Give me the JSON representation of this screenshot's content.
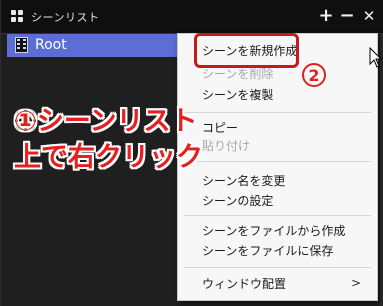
{
  "window": {
    "title": "シーンリスト",
    "add_label": "+",
    "remove_label": "−",
    "close_label": "✕"
  },
  "scene_list": {
    "items": [
      {
        "label": "Root",
        "selected": true
      }
    ]
  },
  "context_menu": {
    "items": [
      {
        "label": "シーンを新規作成",
        "disabled": false
      },
      {
        "label": "シーンを削除",
        "disabled": true
      },
      {
        "label": "シーンを複製",
        "disabled": false
      },
      {
        "label": "コピー",
        "disabled": false
      },
      {
        "label": "貼り付け",
        "disabled": true
      },
      {
        "label": "シーン名を変更",
        "disabled": false
      },
      {
        "label": "シーンの設定",
        "disabled": false
      },
      {
        "label": "シーンをファイルから作成",
        "disabled": false
      },
      {
        "label": "シーンをファイルに保存",
        "disabled": false
      },
      {
        "label": "ウィンドウ配置",
        "disabled": false,
        "submenu": true
      }
    ],
    "submenu_arrow": ">"
  },
  "annotations": {
    "step1_line1": "①シーンリスト",
    "step1_line2": "上で右クリック",
    "step2_badge": "2"
  },
  "colors": {
    "selection": "#5c6dd6",
    "annotation_red": "#e7201f",
    "menu_bg": "#f7f7f7"
  }
}
